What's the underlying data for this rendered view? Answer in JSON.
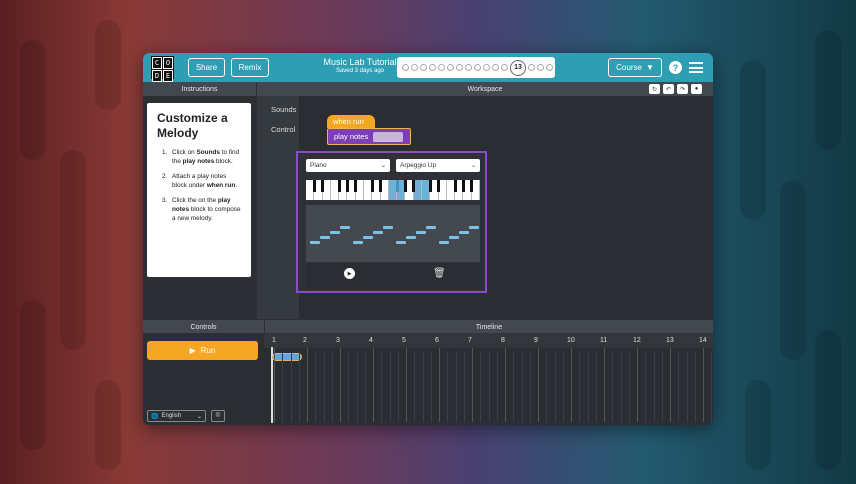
{
  "header": {
    "logo_letters": [
      "C",
      "O",
      "D",
      "E"
    ],
    "share_label": "Share",
    "remix_label": "Remix",
    "title": "Music Lab Tutorial",
    "subtitle": "Saved 3 days ago",
    "progress_current": "13",
    "course_label": "Course",
    "help_label": "?"
  },
  "panels": {
    "instructions_title": "Instructions",
    "workspace_title": "Workspace",
    "controls_title": "Controls",
    "timeline_title": "Timeline"
  },
  "instructions": {
    "heading": "Customize a Melody",
    "steps": [
      {
        "num": "1.",
        "pre": "Click on ",
        "b1": "Sounds",
        "mid": " to find the ",
        "b2": "play notes",
        "post": " block."
      },
      {
        "num": "2.",
        "pre": "Attach a play notes block under ",
        "b1": "when run",
        "mid": ".",
        "b2": "",
        "post": ""
      },
      {
        "num": "3.",
        "pre": "Click the on the ",
        "b1": "play notes",
        "mid": " block to compose a new melody.",
        "b2": "",
        "post": ""
      }
    ]
  },
  "toolbox": {
    "items": [
      "Sounds",
      "Control"
    ]
  },
  "blocks": {
    "when_run": "when run",
    "play_notes": "play notes"
  },
  "editor": {
    "instrument": "Piano",
    "pattern": "Arpeggio Up"
  },
  "controls": {
    "run_label": "Run",
    "language": "English"
  },
  "timeline": {
    "bars": [
      "1",
      "2",
      "3",
      "4",
      "5",
      "6",
      "7",
      "8",
      "9",
      "10",
      "11",
      "12",
      "13",
      "14"
    ]
  },
  "colors": {
    "header": "#2d9eb3",
    "run": "#f5a623",
    "play_notes_block": "#7d3fb3",
    "note": "#7ec0e6"
  }
}
